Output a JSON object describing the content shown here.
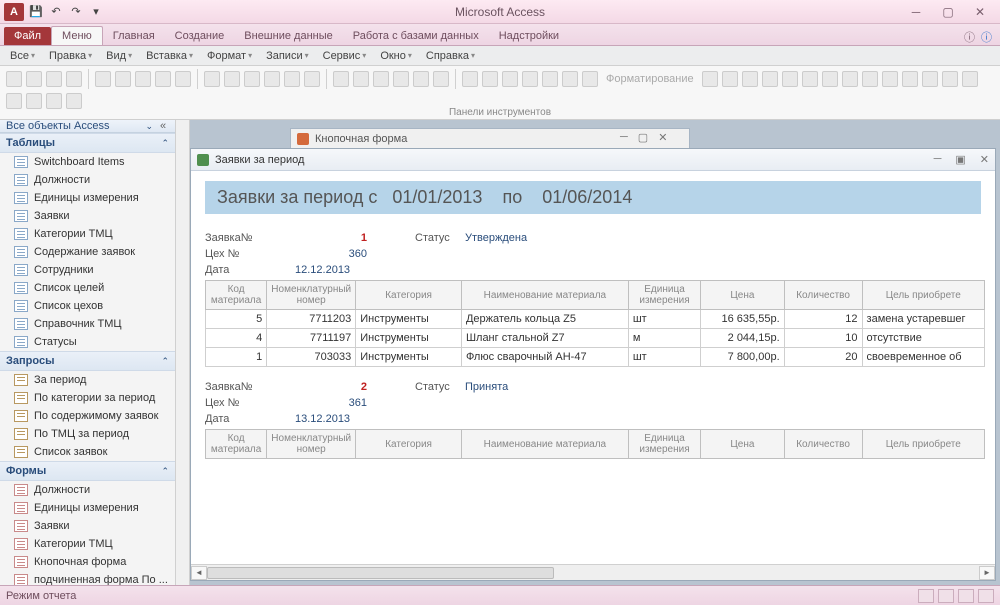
{
  "app_title": "Microsoft Access",
  "tabs": {
    "file": "Файл",
    "menu": "Меню",
    "home": "Главная",
    "create": "Создание",
    "external": "Внешние данные",
    "dbtools": "Работа с базами данных",
    "addins": "Надстройки"
  },
  "ribbon_menu": [
    "Все",
    "Правка",
    "Вид",
    "Вставка",
    "Формат",
    "Записи",
    "Сервис",
    "Окно",
    "Справка"
  ],
  "ribbon_group_label": "Панели инструментов",
  "ribbon_fmt_label": "Форматирование",
  "nav": {
    "header": "Все объекты Access",
    "groups": [
      {
        "title": "Таблицы",
        "items": [
          "Switchboard Items",
          "Должности",
          "Единицы измерения",
          "Заявки",
          "Категории ТМЦ",
          "Содержание заявок",
          "Сотрудники",
          "Список целей",
          "Список цехов",
          "Справочник ТМЦ",
          "Статусы"
        ]
      },
      {
        "title": "Запросы",
        "items": [
          "За период",
          "По категории за период",
          "По содержимому заявок",
          "По ТМЦ за период",
          "Список заявок"
        ]
      },
      {
        "title": "Формы",
        "items": [
          "Должности",
          "Единицы измерения",
          "Заявки",
          "Категории ТМЦ",
          "Кнопочная форма",
          "подчиненная форма По ..."
        ]
      }
    ]
  },
  "bg_window_title": "Кнопочная форма",
  "report": {
    "window_title": "Заявки за период",
    "header_prefix": "Заявки за период с",
    "date_from": "01/01/2013",
    "header_mid": "по",
    "date_to": "01/06/2014",
    "labels": {
      "reqno": "Заявка№",
      "shop": "Цех №",
      "date": "Дата",
      "status": "Статус"
    },
    "columns": [
      "Код материала",
      "Номенклатурный номер",
      "Категория",
      "Наименование материала",
      "Единица измерения",
      "Цена",
      "Количество",
      "Цель приобрете"
    ],
    "requests": [
      {
        "no": "1",
        "shop": "360",
        "date": "12.12.2013",
        "status": "Утверждена",
        "rows": [
          {
            "code": "5",
            "nom": "7711203",
            "cat": "Инструменты",
            "name": "Держатель кольца Z5",
            "unit": "шт",
            "price": "16 635,55р.",
            "qty": "12",
            "goal": "замена устаревшег"
          },
          {
            "code": "4",
            "nom": "7711197",
            "cat": "Инструменты",
            "name": "Шланг стальной Z7",
            "unit": "м",
            "price": "2 044,15р.",
            "qty": "10",
            "goal": "отсутствие"
          },
          {
            "code": "1",
            "nom": "703033",
            "cat": "Инструменты",
            "name": "Флюс сварочный АН-47",
            "unit": "шт",
            "price": "7 800,00р.",
            "qty": "20",
            "goal": "своевременное об"
          }
        ]
      },
      {
        "no": "2",
        "shop": "361",
        "date": "13.12.2013",
        "status": "Принята",
        "rows": []
      }
    ]
  },
  "statusbar": "Режим отчета"
}
